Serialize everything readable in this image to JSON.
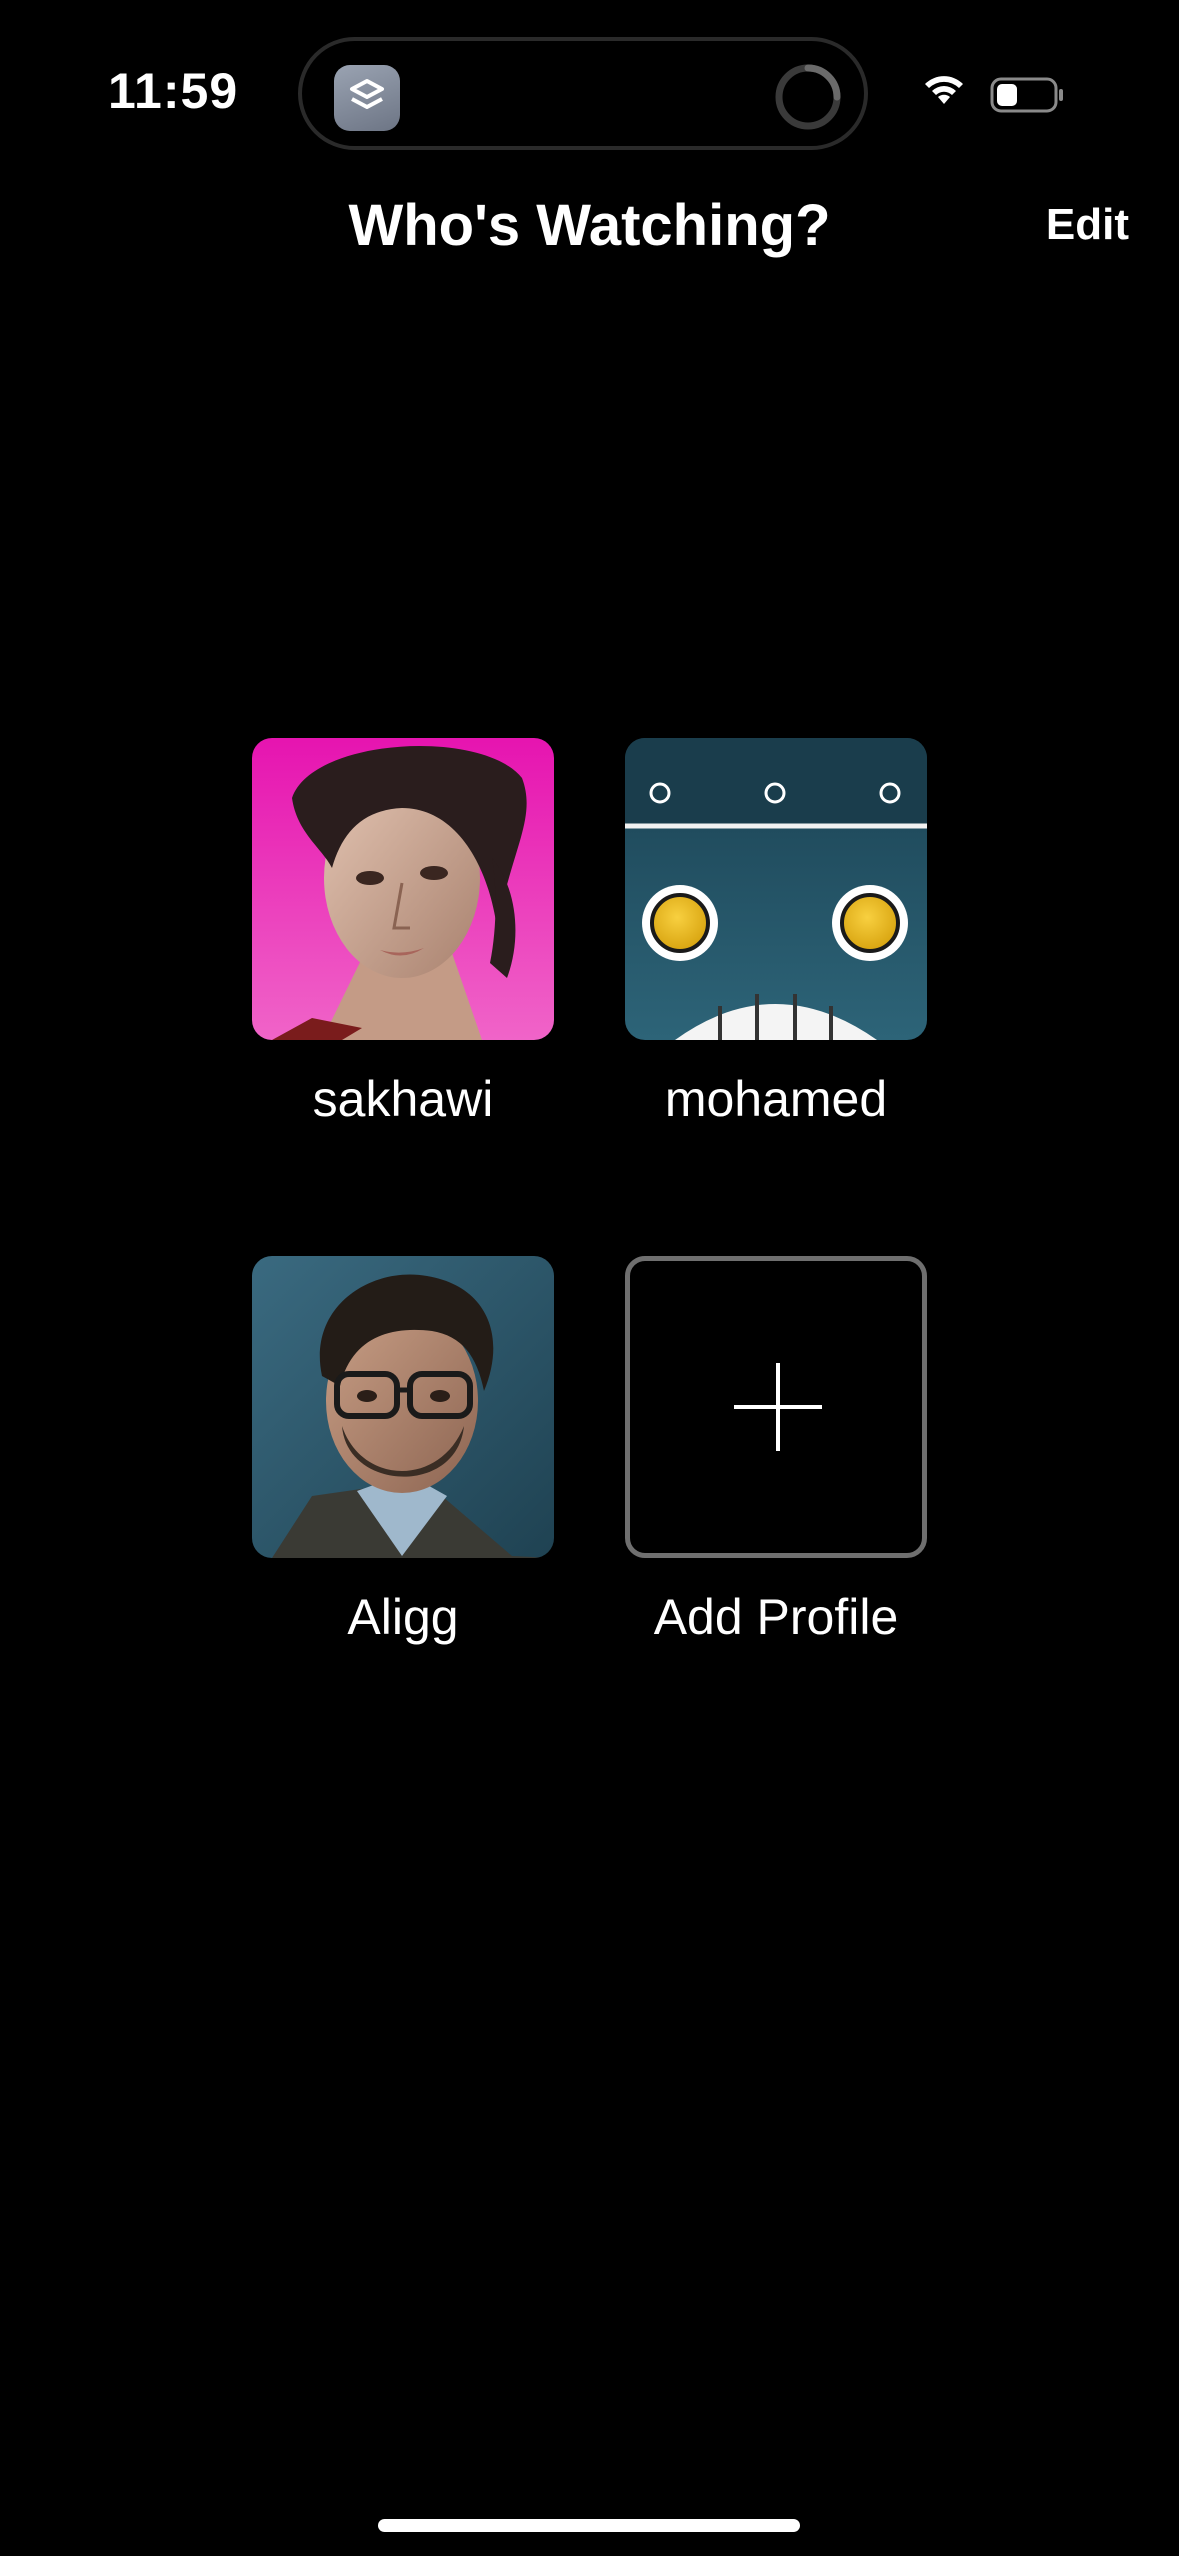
{
  "status_bar": {
    "time": "11:59",
    "wifi_icon": "wifi-icon",
    "battery_icon": "battery-icon"
  },
  "dynamic_island": {
    "app_icon": "shortcuts-app-icon",
    "activity_icon": "loading-spinner-icon"
  },
  "header": {
    "title": "Who's Watching?",
    "edit_label": "Edit"
  },
  "profiles": [
    {
      "name": "sakhawi",
      "avatar": "portrait-pink-background-avatar"
    },
    {
      "name": "mohamed",
      "avatar": "robot-face-avatar"
    },
    {
      "name": "Aligg",
      "avatar": "portrait-glasses-avatar"
    }
  ],
  "add_profile": {
    "label": "Add Profile",
    "icon": "plus-icon"
  },
  "colors": {
    "background": "#000000",
    "text": "#ffffff",
    "add_tile_border": "#6f6f6f",
    "avatar1_bg": "#e21aa8",
    "avatar2_bg": "#1f4f63",
    "avatar3_bg": "#2e5468"
  }
}
